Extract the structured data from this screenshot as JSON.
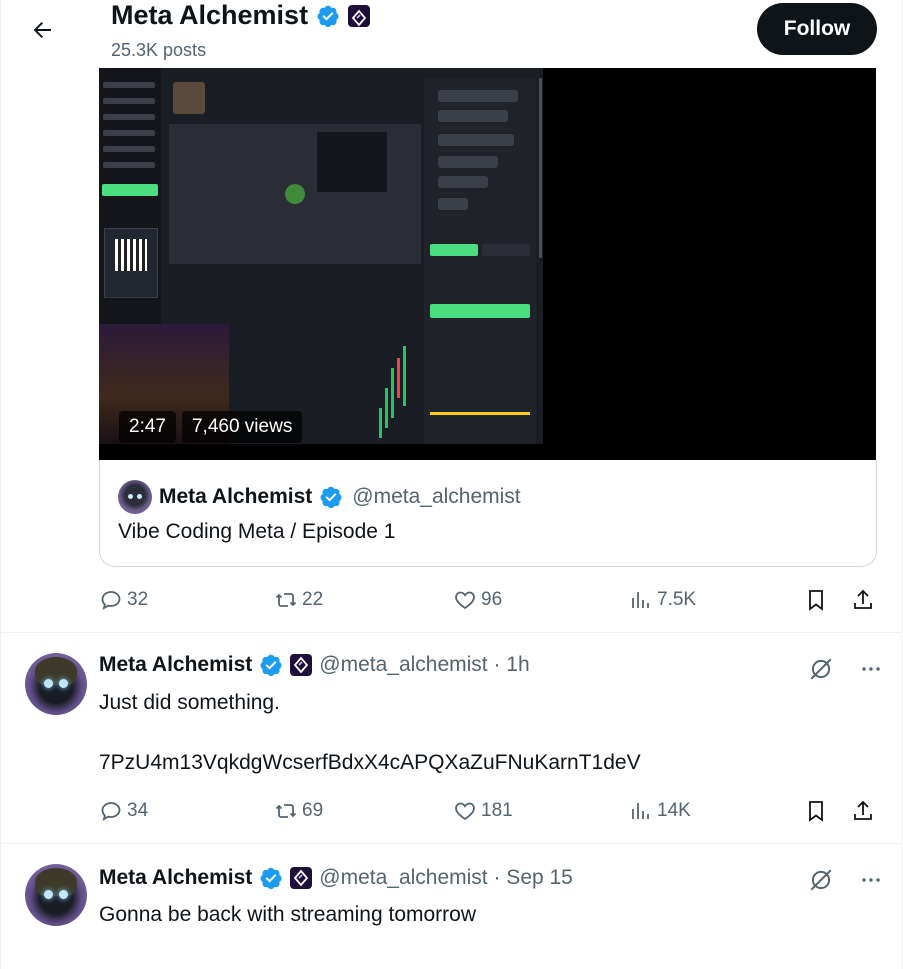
{
  "header": {
    "title": "Meta Alchemist",
    "posts": "25.3K posts",
    "follow_label": "Follow"
  },
  "video": {
    "duration": "2:47",
    "views": "7,460 views"
  },
  "quote": {
    "name": "Meta Alchemist",
    "handle": "@meta_alchemist",
    "text": "Vibe Coding Meta / Episode 1"
  },
  "post_actions": {
    "replies": "32",
    "reposts": "22",
    "likes": "96",
    "views": "7.5K"
  },
  "tweets": [
    {
      "name": "Meta Alchemist",
      "meta": "@meta_alchemist · 1h",
      "text_line1": "Just did something.",
      "text_line2": "7PzU4m13VqkdgWcserfBdxX4cAPQXaZuFNuKarnT1deV",
      "replies": "34",
      "reposts": "69",
      "likes": "181",
      "views": "14K"
    },
    {
      "name": "Meta Alchemist",
      "meta": "@meta_alchemist · Sep 15",
      "text_line1": "Gonna be back with streaming tomorrow"
    }
  ],
  "colors": {
    "verified": "#1d9bf0",
    "text_primary": "#0f1419",
    "text_secondary": "#536471",
    "follow_bg": "#0f1419"
  },
  "icons": {
    "back": "arrow-left-icon",
    "verified": "verified-badge-icon",
    "affiliate": "affiliate-badge-icon",
    "reply": "reply-icon",
    "repost": "repost-icon",
    "like": "like-icon",
    "views": "views-icon",
    "bookmark": "bookmark-icon",
    "share": "share-icon",
    "grok": "grok-icon",
    "more": "more-icon"
  }
}
